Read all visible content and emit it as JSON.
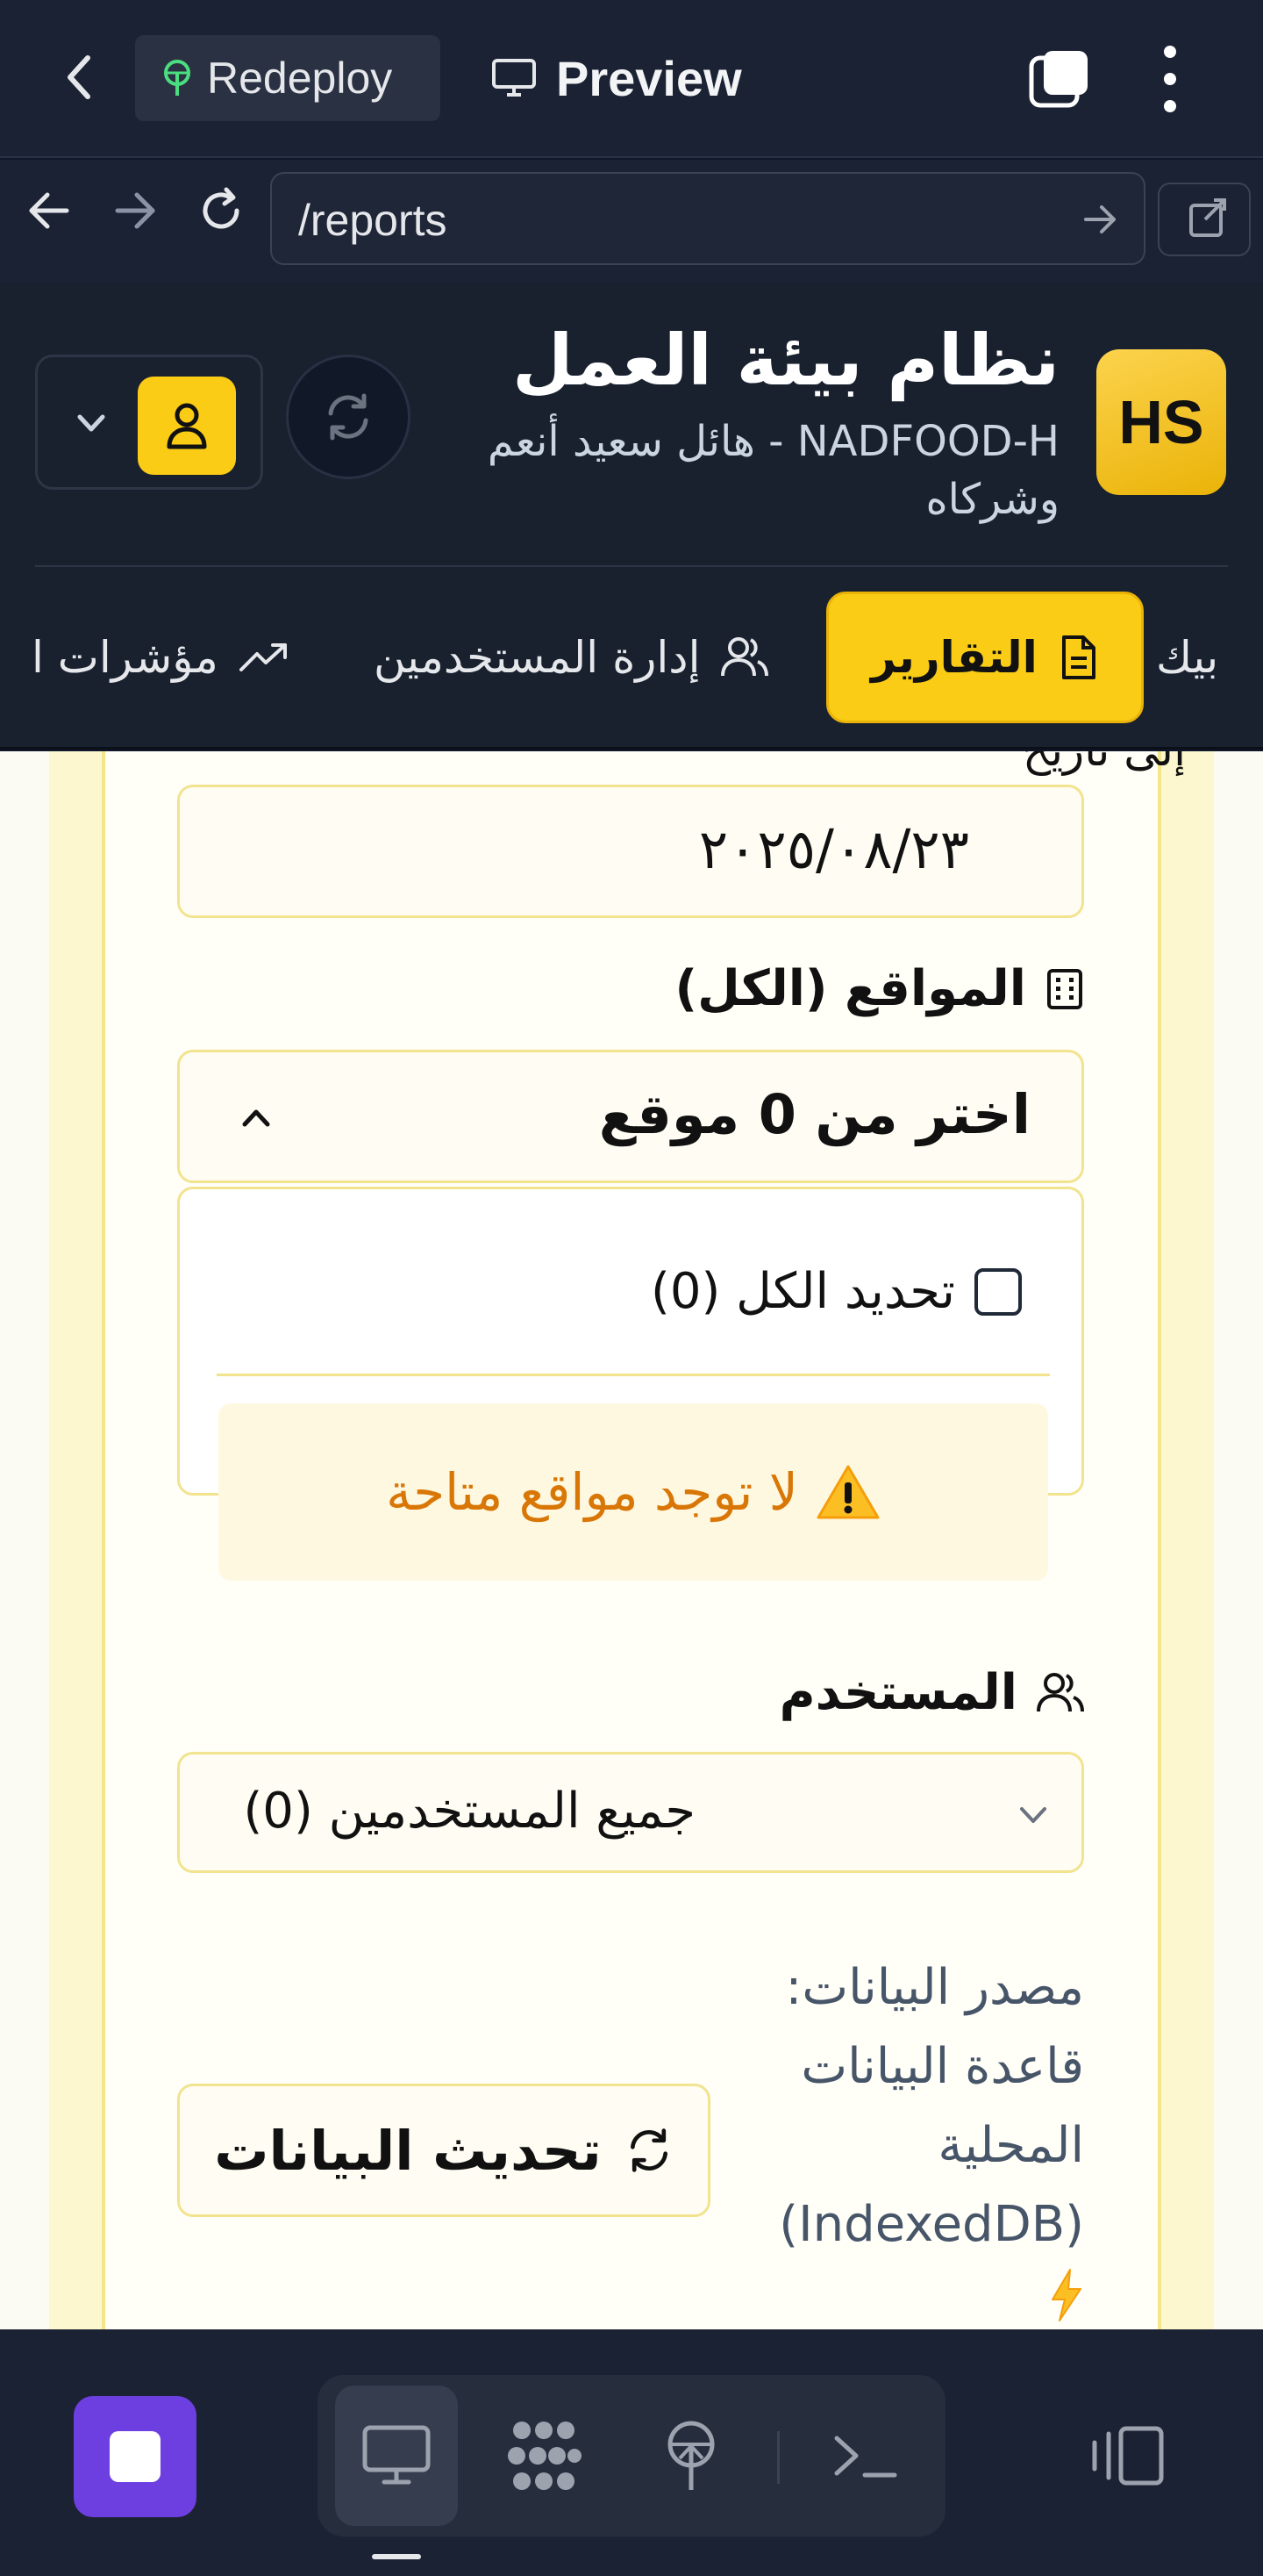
{
  "devbar": {
    "redeploy_label": "Redeploy",
    "preview_label": "Preview"
  },
  "browser": {
    "url": "/reports"
  },
  "app": {
    "logo_text": "HS",
    "title": "نظام بيئة العمل",
    "subtitle": "NADFOOD-H - هائل سعيد أنعم وشركاه"
  },
  "nav": {
    "tabs": [
      {
        "label": "بيك",
        "icon": "partial",
        "active": false
      },
      {
        "label": "التقارير",
        "icon": "document-icon",
        "active": true
      },
      {
        "label": "إدارة المستخدمين",
        "icon": "users-icon",
        "active": false
      },
      {
        "label": "مؤشرات ا",
        "icon": "trending-up-icon",
        "active": false
      }
    ]
  },
  "filters": {
    "date_to_label": "إلى تاريخ",
    "date_to_value": "٢٠٢٥/٠٨/٢٣",
    "sites_label": "المواقع (الكل)",
    "sites_placeholder": "اختر من 0 موقع",
    "select_all_label": "تحديد الكل (0)",
    "no_sites_message": "لا توجد مواقع متاحة",
    "user_label": "المستخدم",
    "user_value": "جميع المستخدمين (0)",
    "data_source": "مصدر البيانات: قاعدة البيانات المحلية (IndexedDB)",
    "refresh_button": "تحديث البيانات"
  },
  "colors": {
    "accent": "#facc15",
    "header_bg": "#19212f",
    "warning_text": "#d97706",
    "stop_button": "#6d3fe0"
  }
}
